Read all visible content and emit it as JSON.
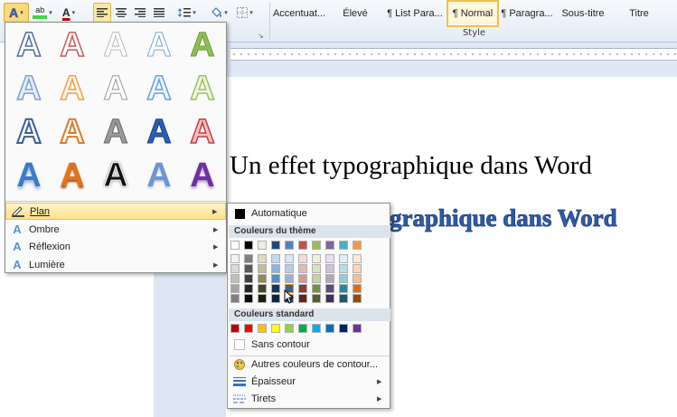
{
  "ribbon": {
    "styles": [
      "Accentuat...",
      "Élevé",
      "¶ List Para...",
      "¶ Normal",
      "¶ Paragra...",
      "Sous-titre",
      "Titre"
    ],
    "active_style": "¶ Normal",
    "group_label": "Style",
    "launcher_glyph": "↘",
    "highlight_label": "ab",
    "font_color_label": "A",
    "effects_label": "A"
  },
  "document": {
    "line1": "Un effet typographique dans Word",
    "line2": "graphique dans Word"
  },
  "effects_menu": {
    "rows": [
      {
        "label": "Plan",
        "highlighted": true
      },
      {
        "label": "Ombre",
        "highlighted": false
      },
      {
        "label": "Réflexion",
        "highlighted": false
      },
      {
        "label": "Lumière",
        "highlighted": false
      }
    ],
    "gallery_glyph": "A"
  },
  "outline_menu": {
    "automatic_label": "Automatique",
    "theme_colors_header": "Couleurs du thème",
    "standard_colors_header": "Couleurs standard",
    "no_outline_label": "Sans contour",
    "more_colors_label": "Autres couleurs de contour...",
    "weight_label": "Épaisseur",
    "dashes_label": "Tirets",
    "automatic_color": "#000000",
    "theme_top": [
      "#ffffff",
      "#000000",
      "#eeece1",
      "#1f497d",
      "#4f81bd",
      "#c0504d",
      "#9bbb59",
      "#8064a2",
      "#4bacc6",
      "#f79646"
    ],
    "theme_shades": [
      [
        "#f2f2f2",
        "#7f7f7f",
        "#ddd9c3",
        "#c6d9f0",
        "#dbe5f1",
        "#f2dcdb",
        "#ebf1dd",
        "#e5e0ec",
        "#dbeef3",
        "#fdeada"
      ],
      [
        "#d8d8d8",
        "#595959",
        "#c4bd97",
        "#8db3e2",
        "#b8cce4",
        "#e5b9b7",
        "#d7e3bc",
        "#ccc1d9",
        "#b7dde8",
        "#fbd5b5"
      ],
      [
        "#bfbfbf",
        "#3f3f3f",
        "#938953",
        "#548dd4",
        "#95b3d7",
        "#d99694",
        "#c3d69b",
        "#b2a2c7",
        "#92cddc",
        "#fac08f"
      ],
      [
        "#a5a5a5",
        "#262626",
        "#494429",
        "#17365d",
        "#366092",
        "#953734",
        "#76923c",
        "#5f497a",
        "#31859b",
        "#e36c09"
      ],
      [
        "#7f7f7f",
        "#0c0c0c",
        "#1d1b10",
        "#0f243e",
        "#244061",
        "#632423",
        "#4f6128",
        "#3f3151",
        "#205867",
        "#974806"
      ]
    ],
    "standard": [
      "#c00000",
      "#ff0000",
      "#ffc000",
      "#ffff00",
      "#92d050",
      "#00b050",
      "#00b0f0",
      "#0070c0",
      "#002060",
      "#7030a0"
    ]
  }
}
